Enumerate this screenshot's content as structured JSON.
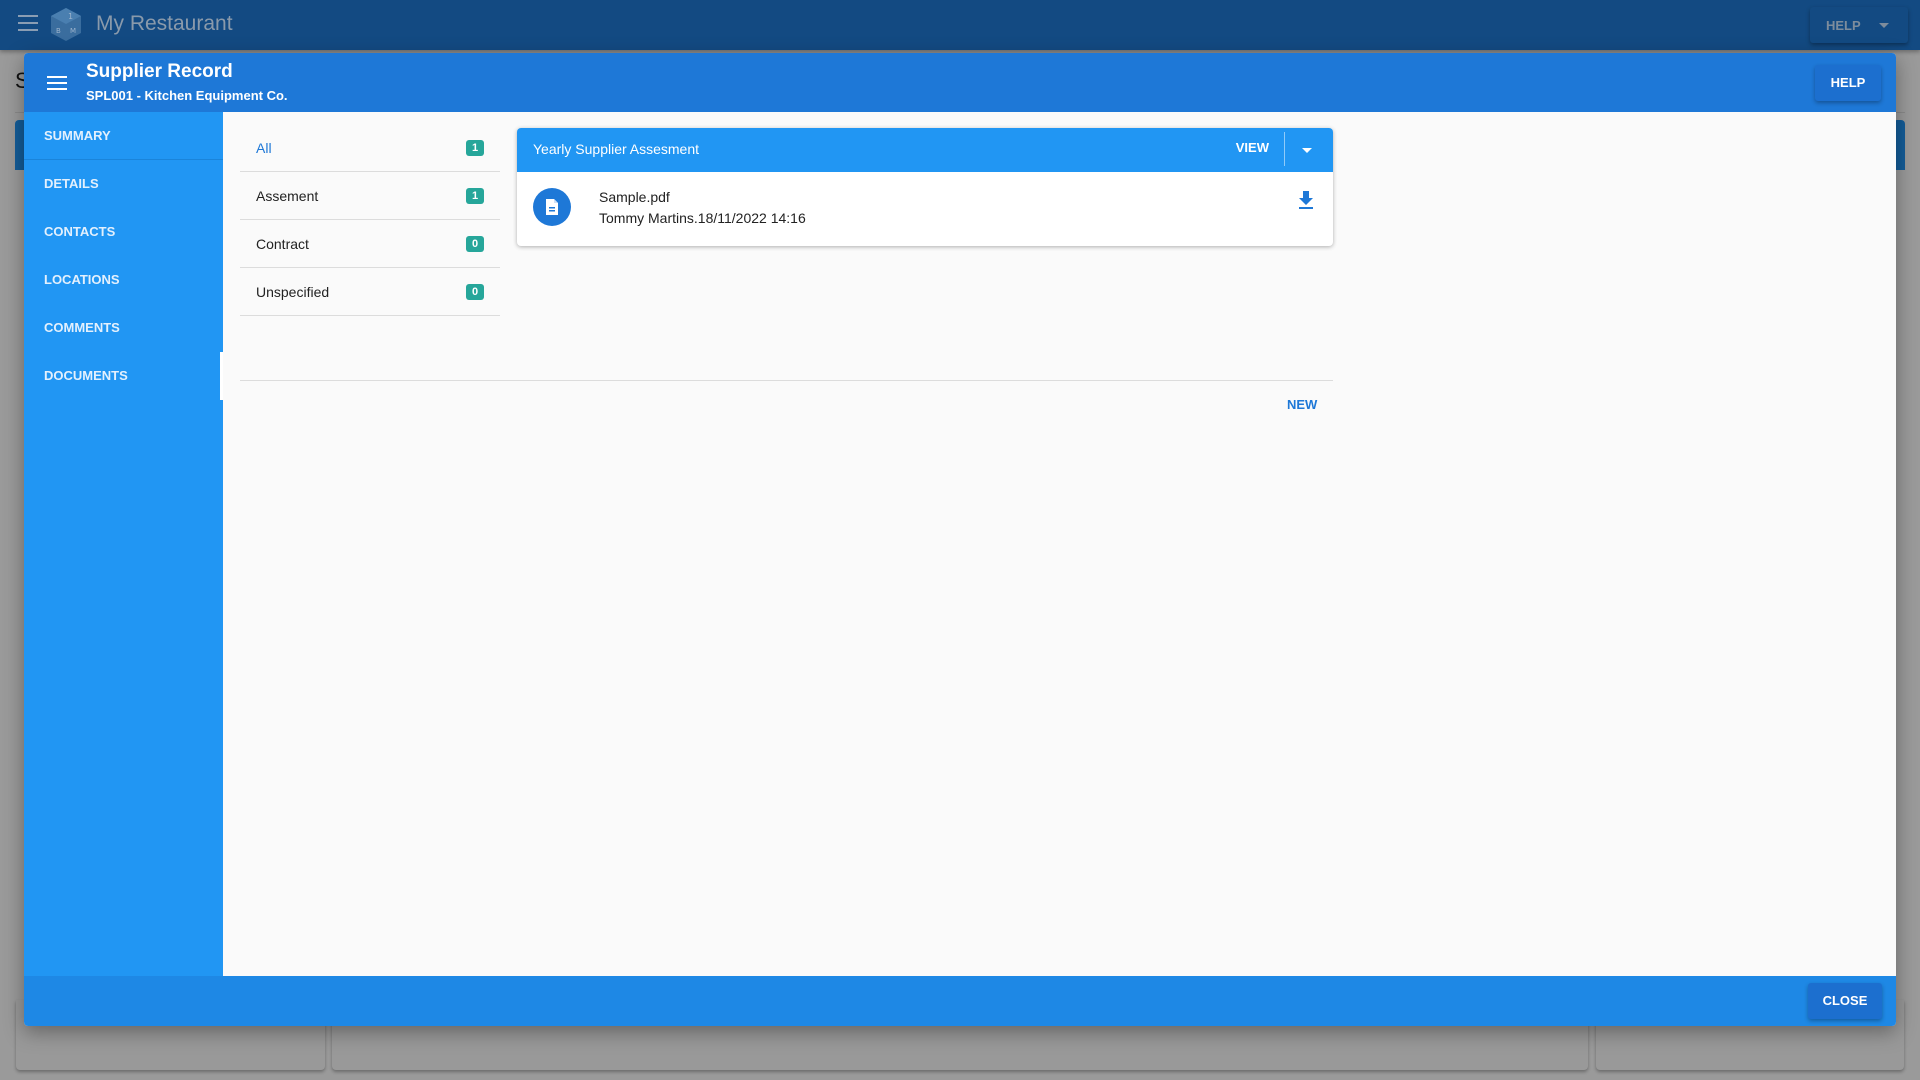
{
  "app": {
    "title": "My Restaurant",
    "help_label": "HELP",
    "background_heading_fragment": "S"
  },
  "modal": {
    "title": "Supplier Record",
    "subtitle": "SPL001 - Kitchen Equipment Co.",
    "help_label": "HELP",
    "close_label": "CLOSE",
    "sidebar": {
      "items": [
        {
          "label": "SUMMARY",
          "active": false
        },
        {
          "label": "DETAILS",
          "active": false
        },
        {
          "label": "CONTACTS",
          "active": false
        },
        {
          "label": "LOCATIONS",
          "active": false
        },
        {
          "label": "COMMENTS",
          "active": false
        },
        {
          "label": "DOCUMENTS",
          "active": true
        }
      ]
    },
    "documents": {
      "categories": [
        {
          "label": "All",
          "count": "1",
          "active": true
        },
        {
          "label": "Assement",
          "count": "1",
          "active": false
        },
        {
          "label": "Contract",
          "count": "0",
          "active": false
        },
        {
          "label": "Unspecified",
          "count": "0",
          "active": false
        }
      ],
      "card": {
        "title": "Yearly Supplier Assesment",
        "view_label": "VIEW",
        "file_name": "Sample.pdf",
        "file_meta": "Tommy Martins.18/11/2022 14:16"
      },
      "new_label": "NEW"
    }
  },
  "colors": {
    "header_blue": "#1e78d7",
    "sidebar_blue": "#2196f3",
    "footer_blue": "#1e88e5",
    "badge_teal": "#26a69a",
    "appbar_dimmed": "#134a82"
  }
}
